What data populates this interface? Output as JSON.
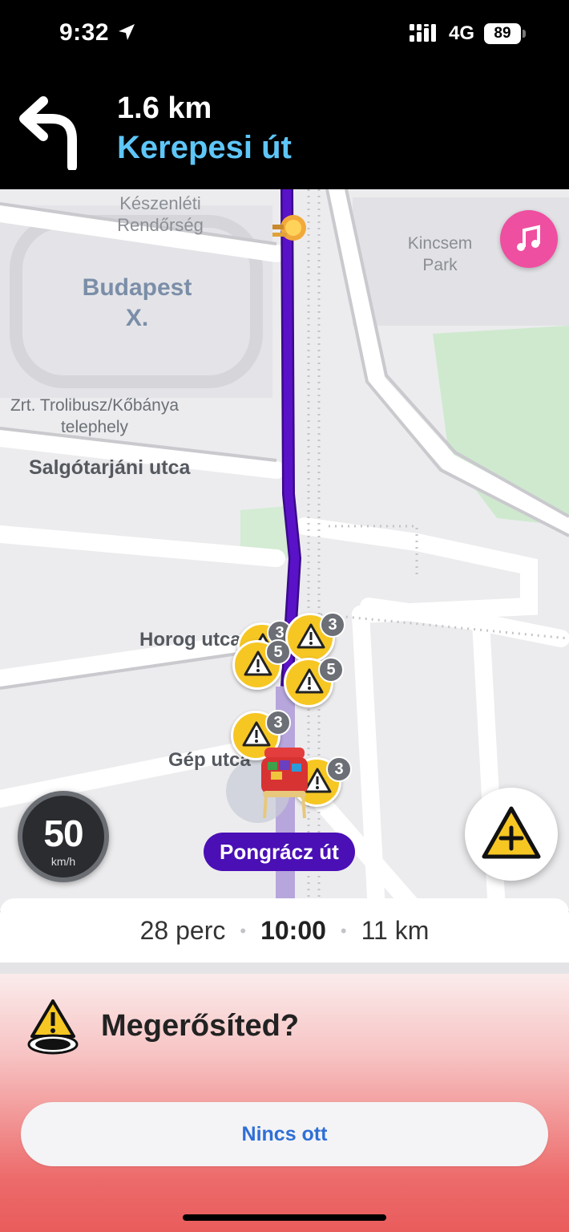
{
  "status_bar": {
    "time": "9:32",
    "network": "4G",
    "battery": "89",
    "icons": [
      "location-arrow-icon",
      "signal-icon",
      "battery-icon"
    ]
  },
  "navigation": {
    "distance": "1.6 km",
    "street": "Kerepesi út",
    "turn_icon": "turn-left-icon"
  },
  "map": {
    "labels": {
      "keszenleti": "Készenléti\nRendőrség",
      "budapest": "Budapest\nX.",
      "kincsem": "Kincsem\nPark",
      "troli": "Zrt. Trolibusz/Kőbánya\ntelephely",
      "salgo": "Salgótarjáni utca",
      "horog": "Horog utca",
      "gep": "Gép utca"
    },
    "hazard_counts": [
      "3",
      "3",
      "5",
      "5",
      "3",
      "3"
    ],
    "current_street": "Pongrácz út",
    "route_color": "#5a12c8"
  },
  "speedometer": {
    "value": "50",
    "unit": "km/h"
  },
  "eta": {
    "duration": "28 perc",
    "arrival": "10:00",
    "distance": "11 km"
  },
  "confirm": {
    "title": "Megerősíted?",
    "dismiss_label": "Nincs ott"
  },
  "colors": {
    "accent_blue": "#5ec6f8",
    "hazard_yellow": "#f6c623",
    "music_pink": "#ee4fa0",
    "pill_purple": "#4a0fb5",
    "link_blue": "#2f6fd6"
  }
}
